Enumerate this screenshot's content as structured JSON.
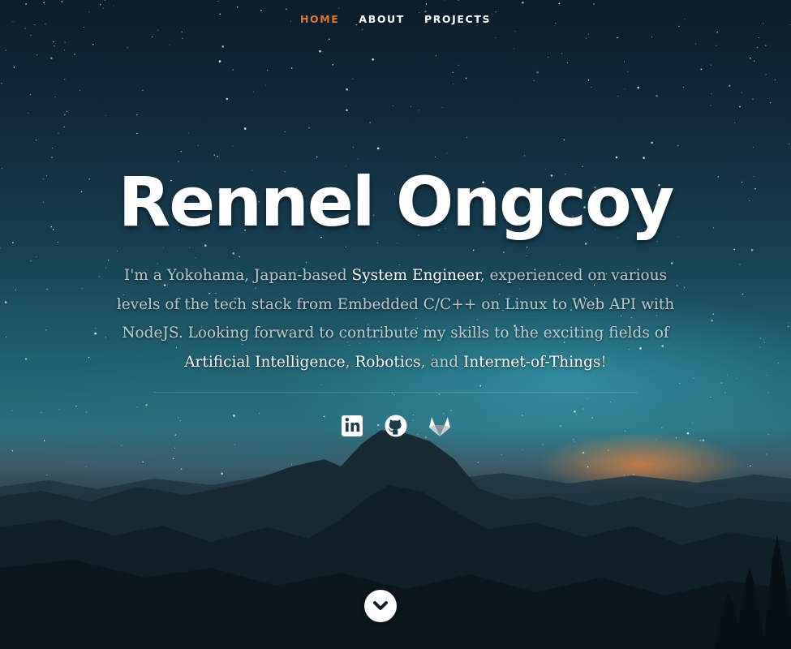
{
  "nav": {
    "items": [
      {
        "label": "HOME",
        "active": true
      },
      {
        "label": "ABOUT",
        "active": false
      },
      {
        "label": "PROJECTS",
        "active": false
      }
    ],
    "active_color": "#e8741e"
  },
  "hero": {
    "title": "Rennel Ongcoy",
    "intro": {
      "p1": "I'm a Yokohama, Japan-based ",
      "h1": "System Engineer",
      "p2": ", experienced on various levels of the tech stack from Embedded C/C++ on Linux to Web API with NodeJS. Looking forward to contribute my skills to the exciting fields of ",
      "h2": "Artificial Intelligence",
      "p3": ", ",
      "h3": "Robotics",
      "p4": ", and ",
      "h4": "Internet-of-Things",
      "p5": "!"
    }
  },
  "social": {
    "items": [
      {
        "icon": "linkedin-icon"
      },
      {
        "icon": "github-icon"
      },
      {
        "icon": "gitlab-icon"
      }
    ]
  },
  "scroll_button": {
    "icon": "chevron-down-icon"
  }
}
